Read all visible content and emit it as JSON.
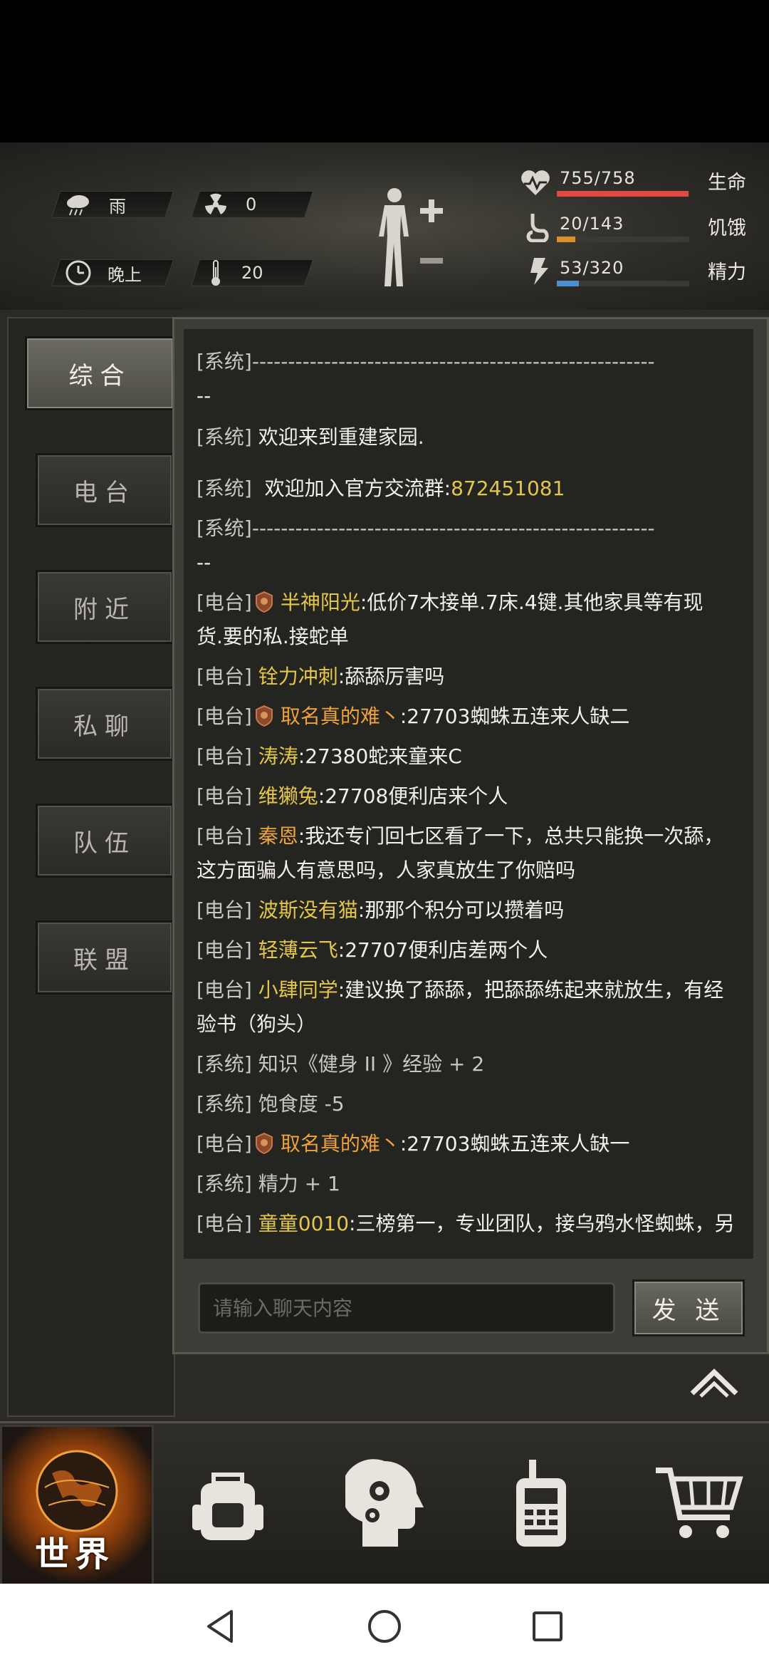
{
  "status": {
    "weather": "雨",
    "radiation": "0",
    "time_of_day": "晚上",
    "temperature": "20",
    "health": {
      "value": "755/758",
      "label": "生命",
      "fraction": 0.996,
      "color": "#e04a42"
    },
    "hunger": {
      "value": "20/143",
      "label": "饥饿",
      "fraction": 0.14,
      "color": "#d98f2a"
    },
    "energy": {
      "value": "53/320",
      "label": "精力",
      "fraction": 0.166,
      "color": "#4a8fd0"
    }
  },
  "tabs": [
    "综合",
    "电台",
    "附近",
    "私聊",
    "队伍",
    "联盟"
  ],
  "active_tab": "综合",
  "chat": {
    "system_tag": "[系统]",
    "radio_tag": "[电台]",
    "separator": "--------------------------------------------------------",
    "separator_tail": "--",
    "welcome": "欢迎来到重建家园.",
    "group_text": "欢迎加入官方交流群:",
    "group_number": "872451081",
    "messages": [
      {
        "name": "半神阳光",
        "text": ":低价7木接单.7床.4键.其他家具等有现",
        "text2": "货.要的私.接蛇单"
      },
      {
        "name": "铨力冲刺",
        "text": ":舔舔厉害吗"
      },
      {
        "name": "取名真的难丶",
        "text": ":27703蜘蛛五连来人缺二"
      },
      {
        "name": "涛涛",
        "text": ":27380蛇来童来C"
      },
      {
        "name": "维獭兔",
        "text": ":27708便利店来个人"
      },
      {
        "name": "秦恩",
        "text": ":我还专门回七区看了一下，总共只能换一次舔，",
        "text2": "这方面骗人有意思吗，人家真放生了你赔吗"
      },
      {
        "name": "波斯没有猫",
        "text": ":那那个积分可以攒着吗"
      },
      {
        "name": "轻薄云飞",
        "text": ":27707便利店差两个人"
      },
      {
        "name": "小肆同学",
        "text": ":建议换了舔舔，把舔舔练起来就放生，有经",
        "text2": "验书（狗头）"
      },
      {
        "name": "取名真的难丶",
        "text": ":27703蜘蛛五连来人缺一"
      },
      {
        "name": "童童0010",
        "text": ":三榜第一，专业团队，接乌鸦水怪蜘蛛，另"
      }
    ],
    "system_msgs": [
      "知识《健身 II 》经验 + 2",
      "饱食度 -5",
      "精力 + 1"
    ],
    "input_placeholder": "请输入聊天内容",
    "send_label": "发 送"
  },
  "bottom_nav": {
    "world_label": "世界"
  }
}
